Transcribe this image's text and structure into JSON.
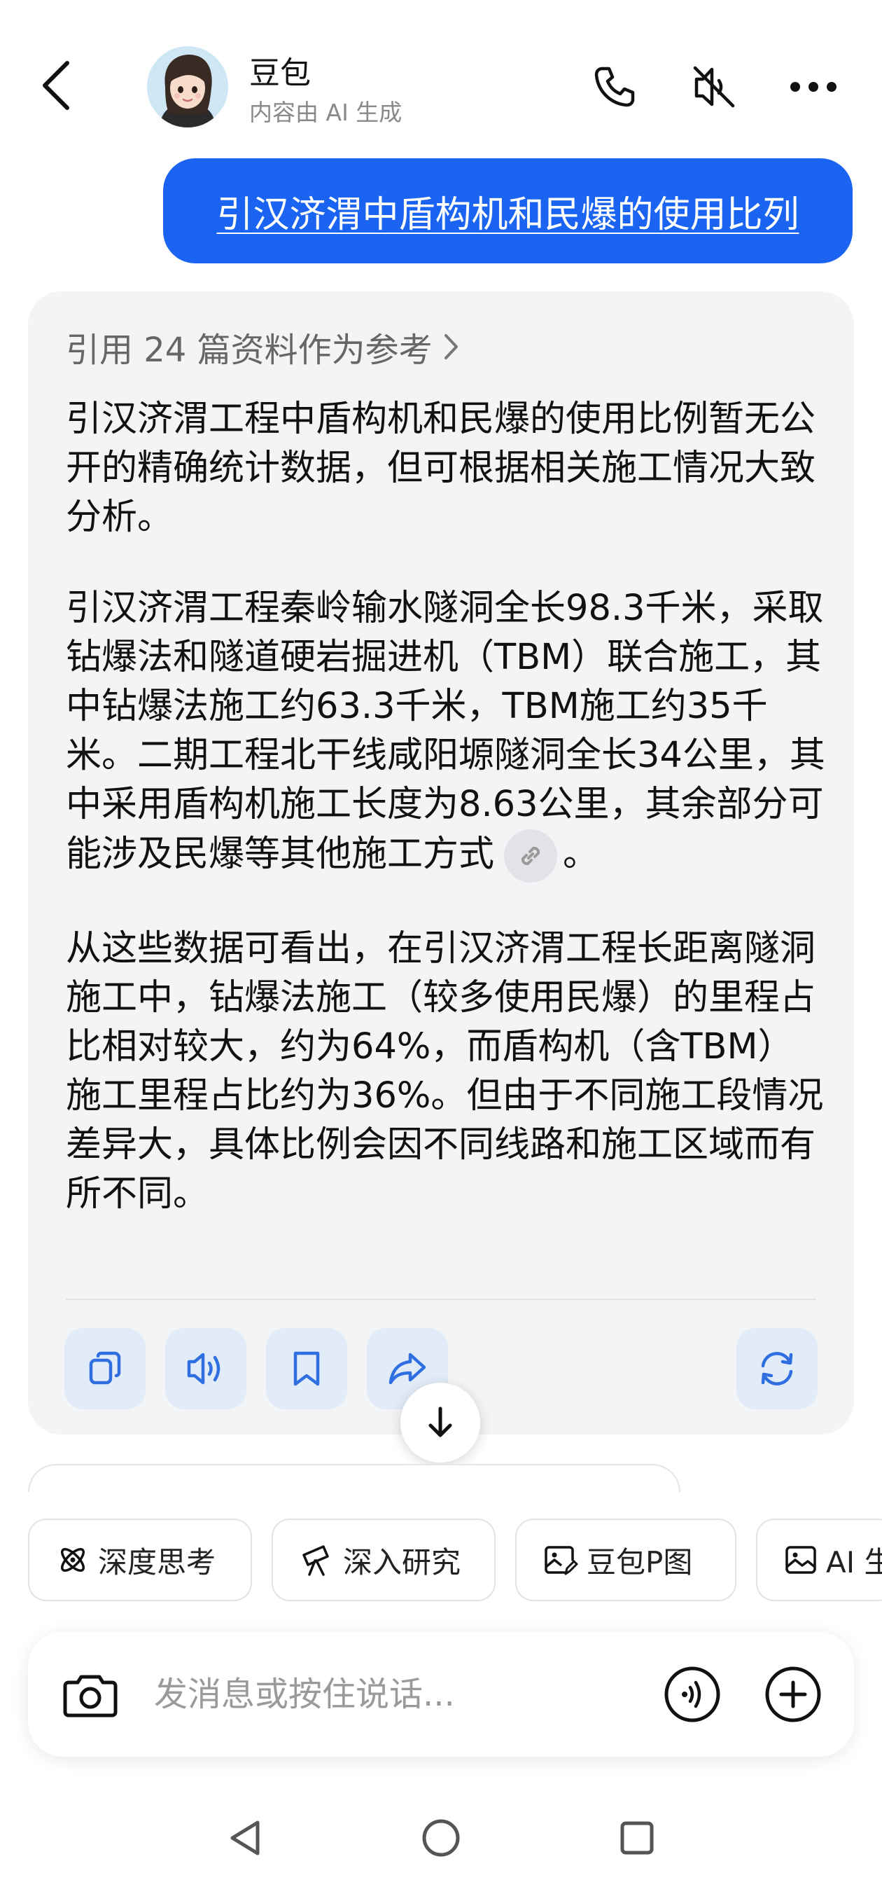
{
  "header": {
    "bot_name": "豆包",
    "bot_subtitle": "内容由 AI 生成",
    "icons": [
      "back-icon",
      "phone-icon",
      "speaker-mute-icon",
      "more-icon"
    ]
  },
  "user_message": "引汉济渭中盾构机和民爆的使用比列",
  "ai_message": {
    "references_label": "引用 24 篇资料作为参考",
    "paragraph1": "引汉济渭工程中盾构机和民爆的使用比例暂无公开的精确统计数据，但可根据相关施工情况大致分析。",
    "paragraph2": "引汉济渭工程秦岭输水隧洞全长98.3千米，采取钻爆法和隧道硬岩掘进机（TBM）联合施工，其中钻爆法施工约63.3千米，TBM施工约35千米。二期工程北干线咸阳塬隧洞全长34公里，其中采用盾构机施工长度为8.63公里，其余部分可能涉及民爆等其他施工方式",
    "paragraph2_end": "。",
    "paragraph3": "从这些数据可看出，在引汉济渭工程长距离隧洞施工中，钻爆法施工（较多使用民爆）的里程占比相对较大，约为64%，而盾构机（含TBM）施工里程占比约为36%。但由于不同施工段情况差异大，具体比例会因不同线路和施工区域而有所不同。",
    "action_icons": [
      "copy-icon",
      "read-aloud-icon",
      "bookmark-icon",
      "share-icon",
      "regenerate-icon"
    ]
  },
  "chips": [
    {
      "label": "深度思考",
      "icon": "atom-icon"
    },
    {
      "label": "深入研究",
      "icon": "telescope-icon"
    },
    {
      "label": "豆包P图",
      "icon": "image-edit-icon"
    },
    {
      "label": "AI 生",
      "icon": "image-icon"
    }
  ],
  "input": {
    "placeholder": "发消息或按住说话..."
  },
  "colors": {
    "accent": "#1b64f2",
    "card_bg": "#f3f4f6",
    "action_bg": "#e2ebf8",
    "action_icon": "#2f6fe0"
  }
}
